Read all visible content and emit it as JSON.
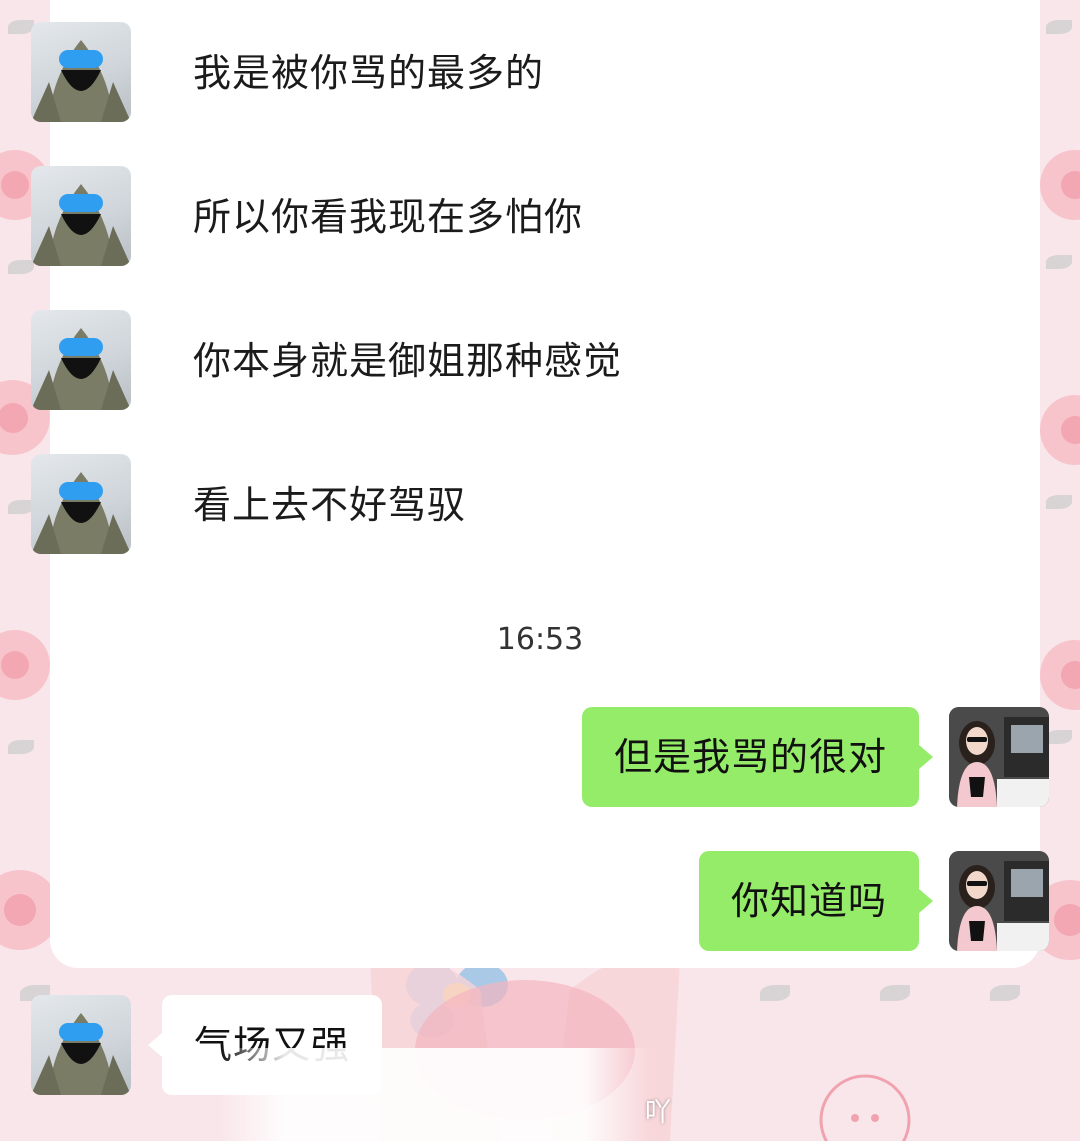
{
  "chat": {
    "incoming_top": [
      {
        "text": "我是被你骂的最多的"
      },
      {
        "text": "所以你看我现在多怕你"
      },
      {
        "text": "你本身就是御姐那种感觉"
      },
      {
        "text": "看上去不好驾驭"
      }
    ],
    "timestamp": "16:53",
    "outgoing": [
      {
        "text": "但是我骂的很对"
      },
      {
        "text": "你知道吗"
      }
    ],
    "incoming_bottom": {
      "text": "气场又强"
    },
    "watermark": "吖"
  },
  "colors": {
    "outgoing_bubble": "#95ec69",
    "incoming_bubble": "#ffffff",
    "wallpaper": "#f9e6ea"
  },
  "icons": {
    "left_avatar": "masked-person-avatar",
    "right_avatar": "woman-in-car-avatar"
  }
}
